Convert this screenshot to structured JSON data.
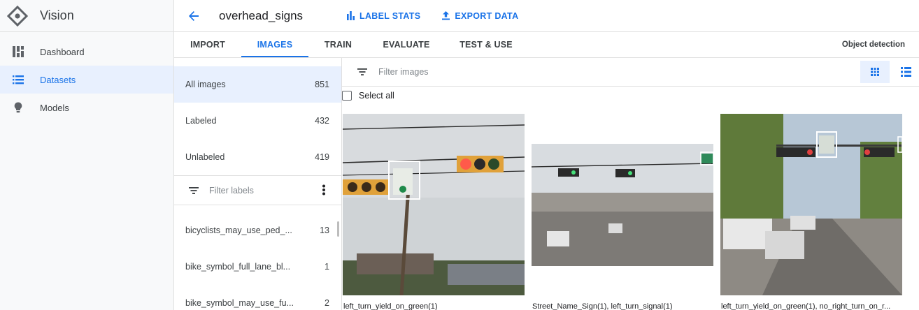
{
  "nav": {
    "product": "Vision",
    "items": [
      {
        "label": "Dashboard",
        "icon": "dashboard-icon"
      },
      {
        "label": "Datasets",
        "icon": "list-icon"
      },
      {
        "label": "Models",
        "icon": "lightbulb-icon"
      }
    ],
    "active_item": "Datasets"
  },
  "header": {
    "back_icon": "arrow-back-icon",
    "dataset_name": "overhead_signs",
    "label_stats": "LABEL STATS",
    "export_data": "EXPORT DATA"
  },
  "tabs": {
    "items": [
      "IMPORT",
      "IMAGES",
      "TRAIN",
      "EVALUATE",
      "TEST & USE"
    ],
    "active": "IMAGES",
    "model_type": "Object detection"
  },
  "filters": {
    "counts": [
      {
        "label": "All images",
        "count": "851"
      },
      {
        "label": "Labeled",
        "count": "432"
      },
      {
        "label": "Unlabeled",
        "count": "419"
      }
    ],
    "active": "All images",
    "label_filter_placeholder": "Filter labels",
    "labels": [
      {
        "name": "bicyclists_may_use_ped_...",
        "count": "13"
      },
      {
        "name": "bike_symbol_full_lane_bl...",
        "count": "1"
      },
      {
        "name": "bike_symbol_may_use_fu...",
        "count": "2"
      }
    ]
  },
  "main": {
    "filter_placeholder": "Filter images",
    "select_all": "Select all",
    "view_modes": [
      "grid-view-icon",
      "list-view-icon"
    ],
    "active_view": "grid-view-icon",
    "images": [
      {
        "caption": "left_turn_yield_on_green(1)"
      },
      {
        "caption": "Street_Name_Sign(1), left_turn_signal(1)"
      },
      {
        "caption": "left_turn_yield_on_green(1), no_right_turn_on_r..."
      }
    ]
  },
  "colors": {
    "accent": "#1a73e8",
    "active_bg": "#e8f0fe",
    "sidebar_bg": "#f8f9fa",
    "bounding_box": "#ffffff"
  }
}
